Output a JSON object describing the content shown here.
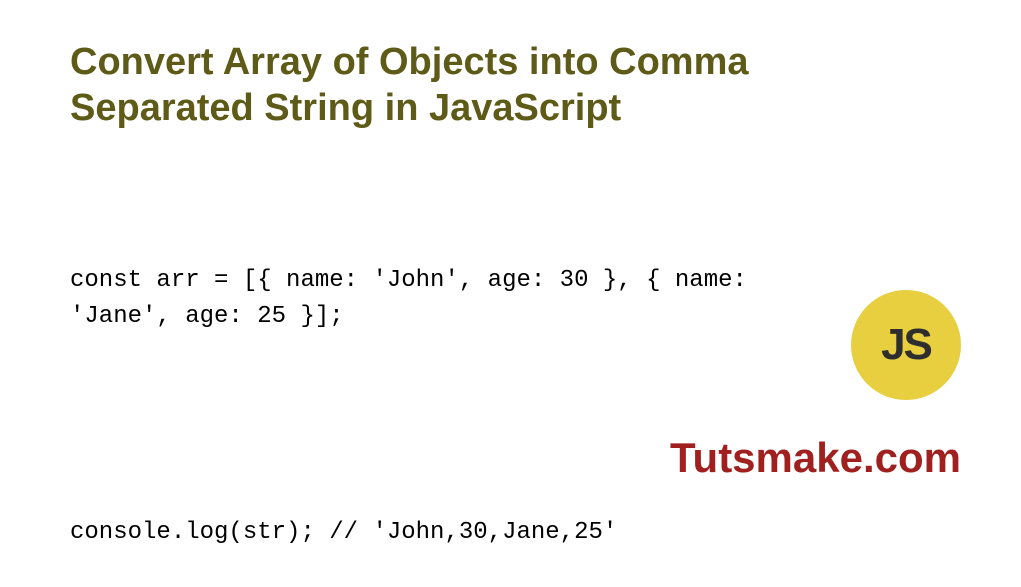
{
  "title": "Convert Array of Objects into Comma Separated String in JavaScript",
  "code": {
    "line1": "const arr = [{ name: 'John', age: 30 }, { name: 'Jane', age: 25 }];",
    "line2": "console.log(str); // 'John,30,Jane,25'"
  },
  "badge": {
    "label": "JS"
  },
  "brand": "Tutsmake.com"
}
